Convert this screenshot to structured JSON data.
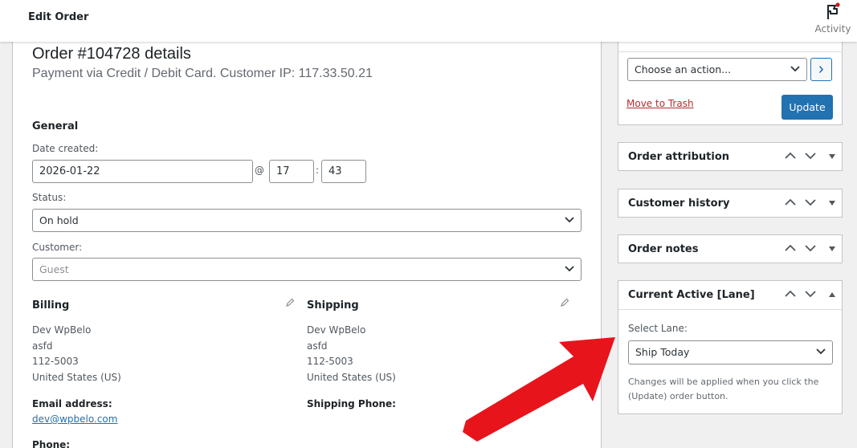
{
  "topbar": {
    "title": "Edit Order",
    "activity_label": "Activity"
  },
  "order": {
    "title": "Order #104728 details",
    "subtitle": "Payment via Credit / Debit Card. Customer IP: 117.33.50.21"
  },
  "general": {
    "heading": "General",
    "date_label": "Date created:",
    "date_value": "2026-01-22",
    "at_symbol": "@",
    "hour_value": "17",
    "time_sep": ":",
    "minute_value": "43",
    "status_label": "Status:",
    "status_value": "On hold",
    "customer_label": "Customer:",
    "customer_placeholder": "Guest"
  },
  "billing": {
    "heading": "Billing",
    "lines": [
      "Dev WpBelo",
      "asfd",
      "112-5003",
      "United States (US)"
    ],
    "email_label": "Email address:",
    "email_value": "dev@wpbelo.com",
    "phone_label": "Phone:"
  },
  "shipping": {
    "heading": "Shipping",
    "lines": [
      "Dev WpBelo",
      "asfd",
      "112-5003",
      "United States (US)"
    ],
    "phone_label": "Shipping Phone:"
  },
  "actions": {
    "select_value": "Choose an action...",
    "trash_label": "Move to Trash",
    "update_label": "Update"
  },
  "panels": {
    "attribution": "Order attribution",
    "history": "Customer history",
    "notes": "Order notes",
    "lane": "Current Active [Lane]"
  },
  "lane": {
    "select_label": "Select Lane:",
    "select_value": "Ship Today",
    "help_text": "Changes will be applied when you click the (Update) order button."
  },
  "colors": {
    "primary": "#2271b1",
    "danger": "#b32d2e",
    "annotation_arrow": "#e8141b"
  }
}
